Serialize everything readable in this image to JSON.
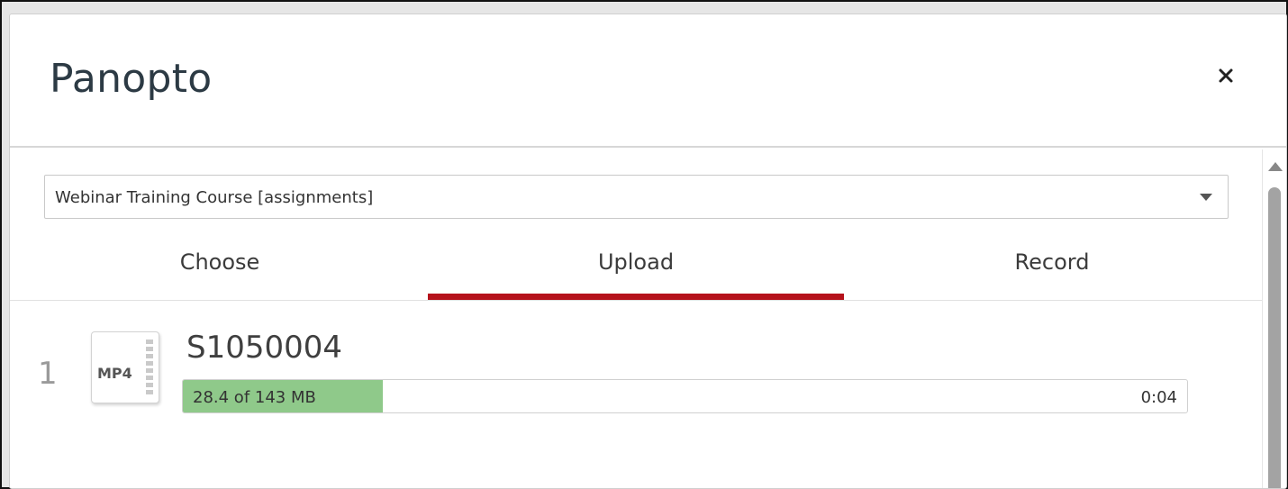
{
  "dialog": {
    "title": "Panopto",
    "close_icon": "close-icon"
  },
  "folder": {
    "selected": "Webinar Training Course [assignments]"
  },
  "tabs": [
    {
      "label": "Choose",
      "active": false
    },
    {
      "label": "Upload",
      "active": true
    },
    {
      "label": "Record",
      "active": false
    }
  ],
  "colors": {
    "accent": "#b5121b",
    "progress": "#8fc98a"
  },
  "uploads": [
    {
      "index": "1",
      "type": "MP4",
      "icon": "video-file-icon",
      "name": "S1050004",
      "progress_text": "28.4 of 143 MB",
      "progress_fraction": 0.199,
      "time": "0:04"
    }
  ]
}
